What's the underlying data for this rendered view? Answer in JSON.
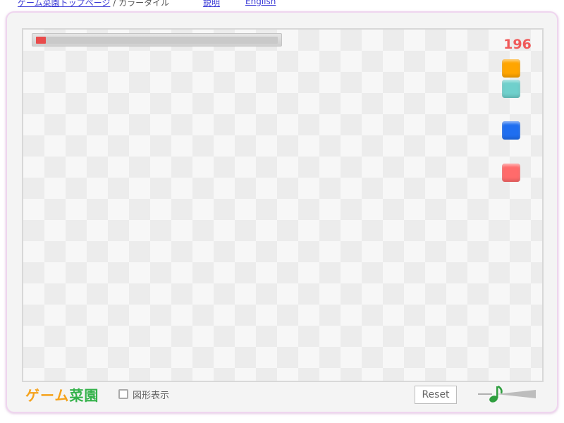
{
  "topbar": {
    "home_link": "ゲーム菜園トップページ",
    "separator": " / ",
    "page_name": "カラータイル",
    "help_link": "説明",
    "english_link": "English"
  },
  "game": {
    "score": "196",
    "timer_progress": 0.04,
    "timer_color": "#e94b4b",
    "tiles": [
      {
        "color": "orange",
        "hex": "#ffa500"
      },
      {
        "color": "turquoise",
        "hex": "#6fd0cc"
      },
      {
        "color": "blue",
        "hex": "#1f6ef0"
      },
      {
        "color": "pink-red",
        "hex": "#ff6b6b"
      }
    ]
  },
  "footer": {
    "logo_part1": "ゲーム",
    "logo_part2": "菜園",
    "shape_toggle_label": "図形表示",
    "reset_label": "Reset",
    "sound_icon": "music-note-icon"
  }
}
